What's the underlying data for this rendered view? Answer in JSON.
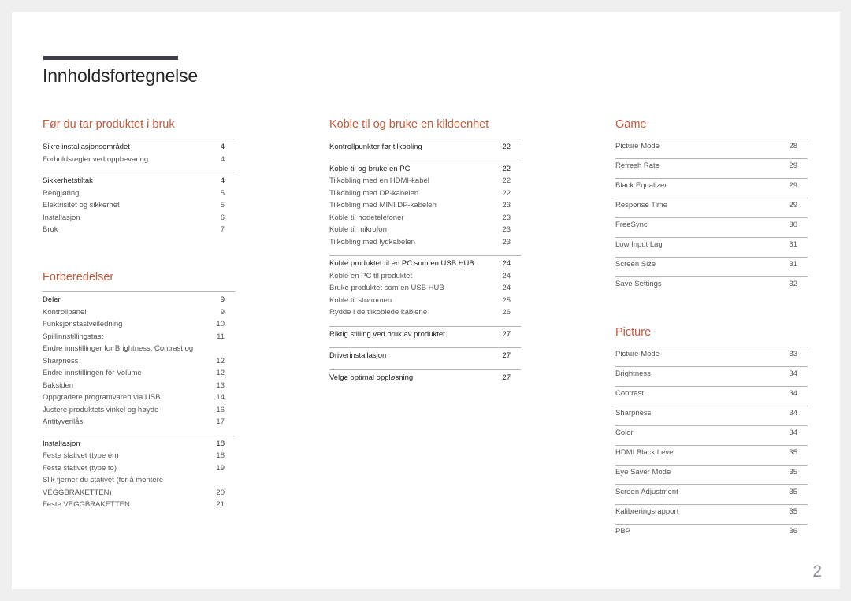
{
  "document": {
    "title": "Innholdsfortegnelse",
    "page_number": "2",
    "accent_color": "#c25a3c",
    "title_bar_color": "#3f3e4c"
  },
  "sections": {
    "before_use": {
      "title": "Før du tar produktet i bruk",
      "groups": [
        {
          "items": [
            {
              "label": "Sikre installasjonsområdet",
              "page": "4",
              "head": true
            },
            {
              "label": "Forholdsregler ved oppbevaring",
              "page": "4"
            }
          ]
        },
        {
          "items": [
            {
              "label": "Sikkerhetstiltak",
              "page": "4",
              "head": true
            },
            {
              "label": "Rengjøring",
              "page": "5"
            },
            {
              "label": "Elektrisitet og sikkerhet",
              "page": "5"
            },
            {
              "label": "Installasjon",
              "page": "6"
            },
            {
              "label": "Bruk",
              "page": "7"
            }
          ]
        }
      ]
    },
    "preparations": {
      "title": "Forberedelser",
      "groups": [
        {
          "items": [
            {
              "label": "Deler",
              "page": "9",
              "head": true
            },
            {
              "label": "Kontrollpanel",
              "page": "9"
            },
            {
              "label": "Funksjonstastveiledning",
              "page": "10"
            },
            {
              "label": "Spillinnstillingstast",
              "page": "11"
            },
            {
              "label": "Endre innstillinger for Brightness, Contrast og",
              "page": ""
            },
            {
              "label": "Sharpness",
              "page": "12"
            },
            {
              "label": "Endre innstillingen for Volume",
              "page": "12"
            },
            {
              "label": "Baksiden",
              "page": "13"
            },
            {
              "label": "Oppgradere programvaren via USB",
              "page": "14"
            },
            {
              "label": "Justere produktets vinkel og høyde",
              "page": "16"
            },
            {
              "label": "Antityverilås",
              "page": "17"
            }
          ]
        },
        {
          "items": [
            {
              "label": "Installasjon",
              "page": "18",
              "head": true
            },
            {
              "label": "Feste stativet (type én)",
              "page": "18"
            },
            {
              "label": "Feste stativet (type to)",
              "page": "19"
            },
            {
              "label": "Slik fjerner du stativet (for å montere",
              "page": ""
            },
            {
              "label": "VEGGBRAKETTEN)",
              "page": "20"
            },
            {
              "label": "Feste VEGGBRAKETTEN",
              "page": "21"
            }
          ]
        }
      ]
    },
    "connect": {
      "title": "Koble til og bruke en kildeenhet",
      "groups": [
        {
          "items": [
            {
              "label": "Kontrollpunkter før tilkobling",
              "page": "22",
              "head": true
            }
          ]
        },
        {
          "items": [
            {
              "label": "Koble til og bruke en PC",
              "page": "22",
              "head": true
            },
            {
              "label": "Tilkobling med en HDMI-kabel",
              "page": "22"
            },
            {
              "label": "Tilkobling med DP-kabelen",
              "page": "22"
            },
            {
              "label": "Tilkobling med MINI DP-kabelen",
              "page": "23"
            },
            {
              "label": "Koble til hodetelefoner",
              "page": "23"
            },
            {
              "label": "Koble til mikrofon",
              "page": "23"
            },
            {
              "label": "Tilkobling med lydkabelen",
              "page": "23"
            }
          ]
        },
        {
          "items": [
            {
              "label": "Koble produktet til en PC som en USB HUB",
              "page": "24",
              "head": true
            },
            {
              "label": "Koble en PC til produktet",
              "page": "24"
            },
            {
              "label": "Bruke produktet som en USB HUB",
              "page": "24"
            },
            {
              "label": "Koble til strømmen",
              "page": "25"
            },
            {
              "label": "Rydde i de tilkoblede kablene",
              "page": "26"
            }
          ]
        },
        {
          "items": [
            {
              "label": "Riktig stilling ved bruk av produktet",
              "page": "27",
              "head": true
            }
          ]
        },
        {
          "items": [
            {
              "label": "Driverinstallasjon",
              "page": "27",
              "head": true
            }
          ]
        },
        {
          "items": [
            {
              "label": "Velge optimal oppløsning",
              "page": "27",
              "head": true
            }
          ]
        }
      ]
    },
    "game": {
      "title": "Game",
      "items": [
        {
          "label": "Picture Mode",
          "page": "28"
        },
        {
          "label": "Refresh Rate",
          "page": "29"
        },
        {
          "label": "Black Equalizer",
          "page": "29"
        },
        {
          "label": "Response Time",
          "page": "29"
        },
        {
          "label": "FreeSync",
          "page": "30"
        },
        {
          "label": "Low Input Lag",
          "page": "31"
        },
        {
          "label": "Screen Size",
          "page": "31"
        },
        {
          "label": "Save Settings",
          "page": "32"
        }
      ]
    },
    "picture": {
      "title": "Picture",
      "items": [
        {
          "label": "Picture Mode",
          "page": "33"
        },
        {
          "label": "Brightness",
          "page": "34"
        },
        {
          "label": "Contrast",
          "page": "34"
        },
        {
          "label": "Sharpness",
          "page": "34"
        },
        {
          "label": "Color",
          "page": "34"
        },
        {
          "label": "HDMI Black Level",
          "page": "35"
        },
        {
          "label": "Eye Saver Mode",
          "page": "35"
        },
        {
          "label": "Screen Adjustment",
          "page": "35"
        },
        {
          "label": "Kalibreringsrapport",
          "page": "35"
        },
        {
          "label": "PBP",
          "page": "36"
        }
      ]
    }
  }
}
